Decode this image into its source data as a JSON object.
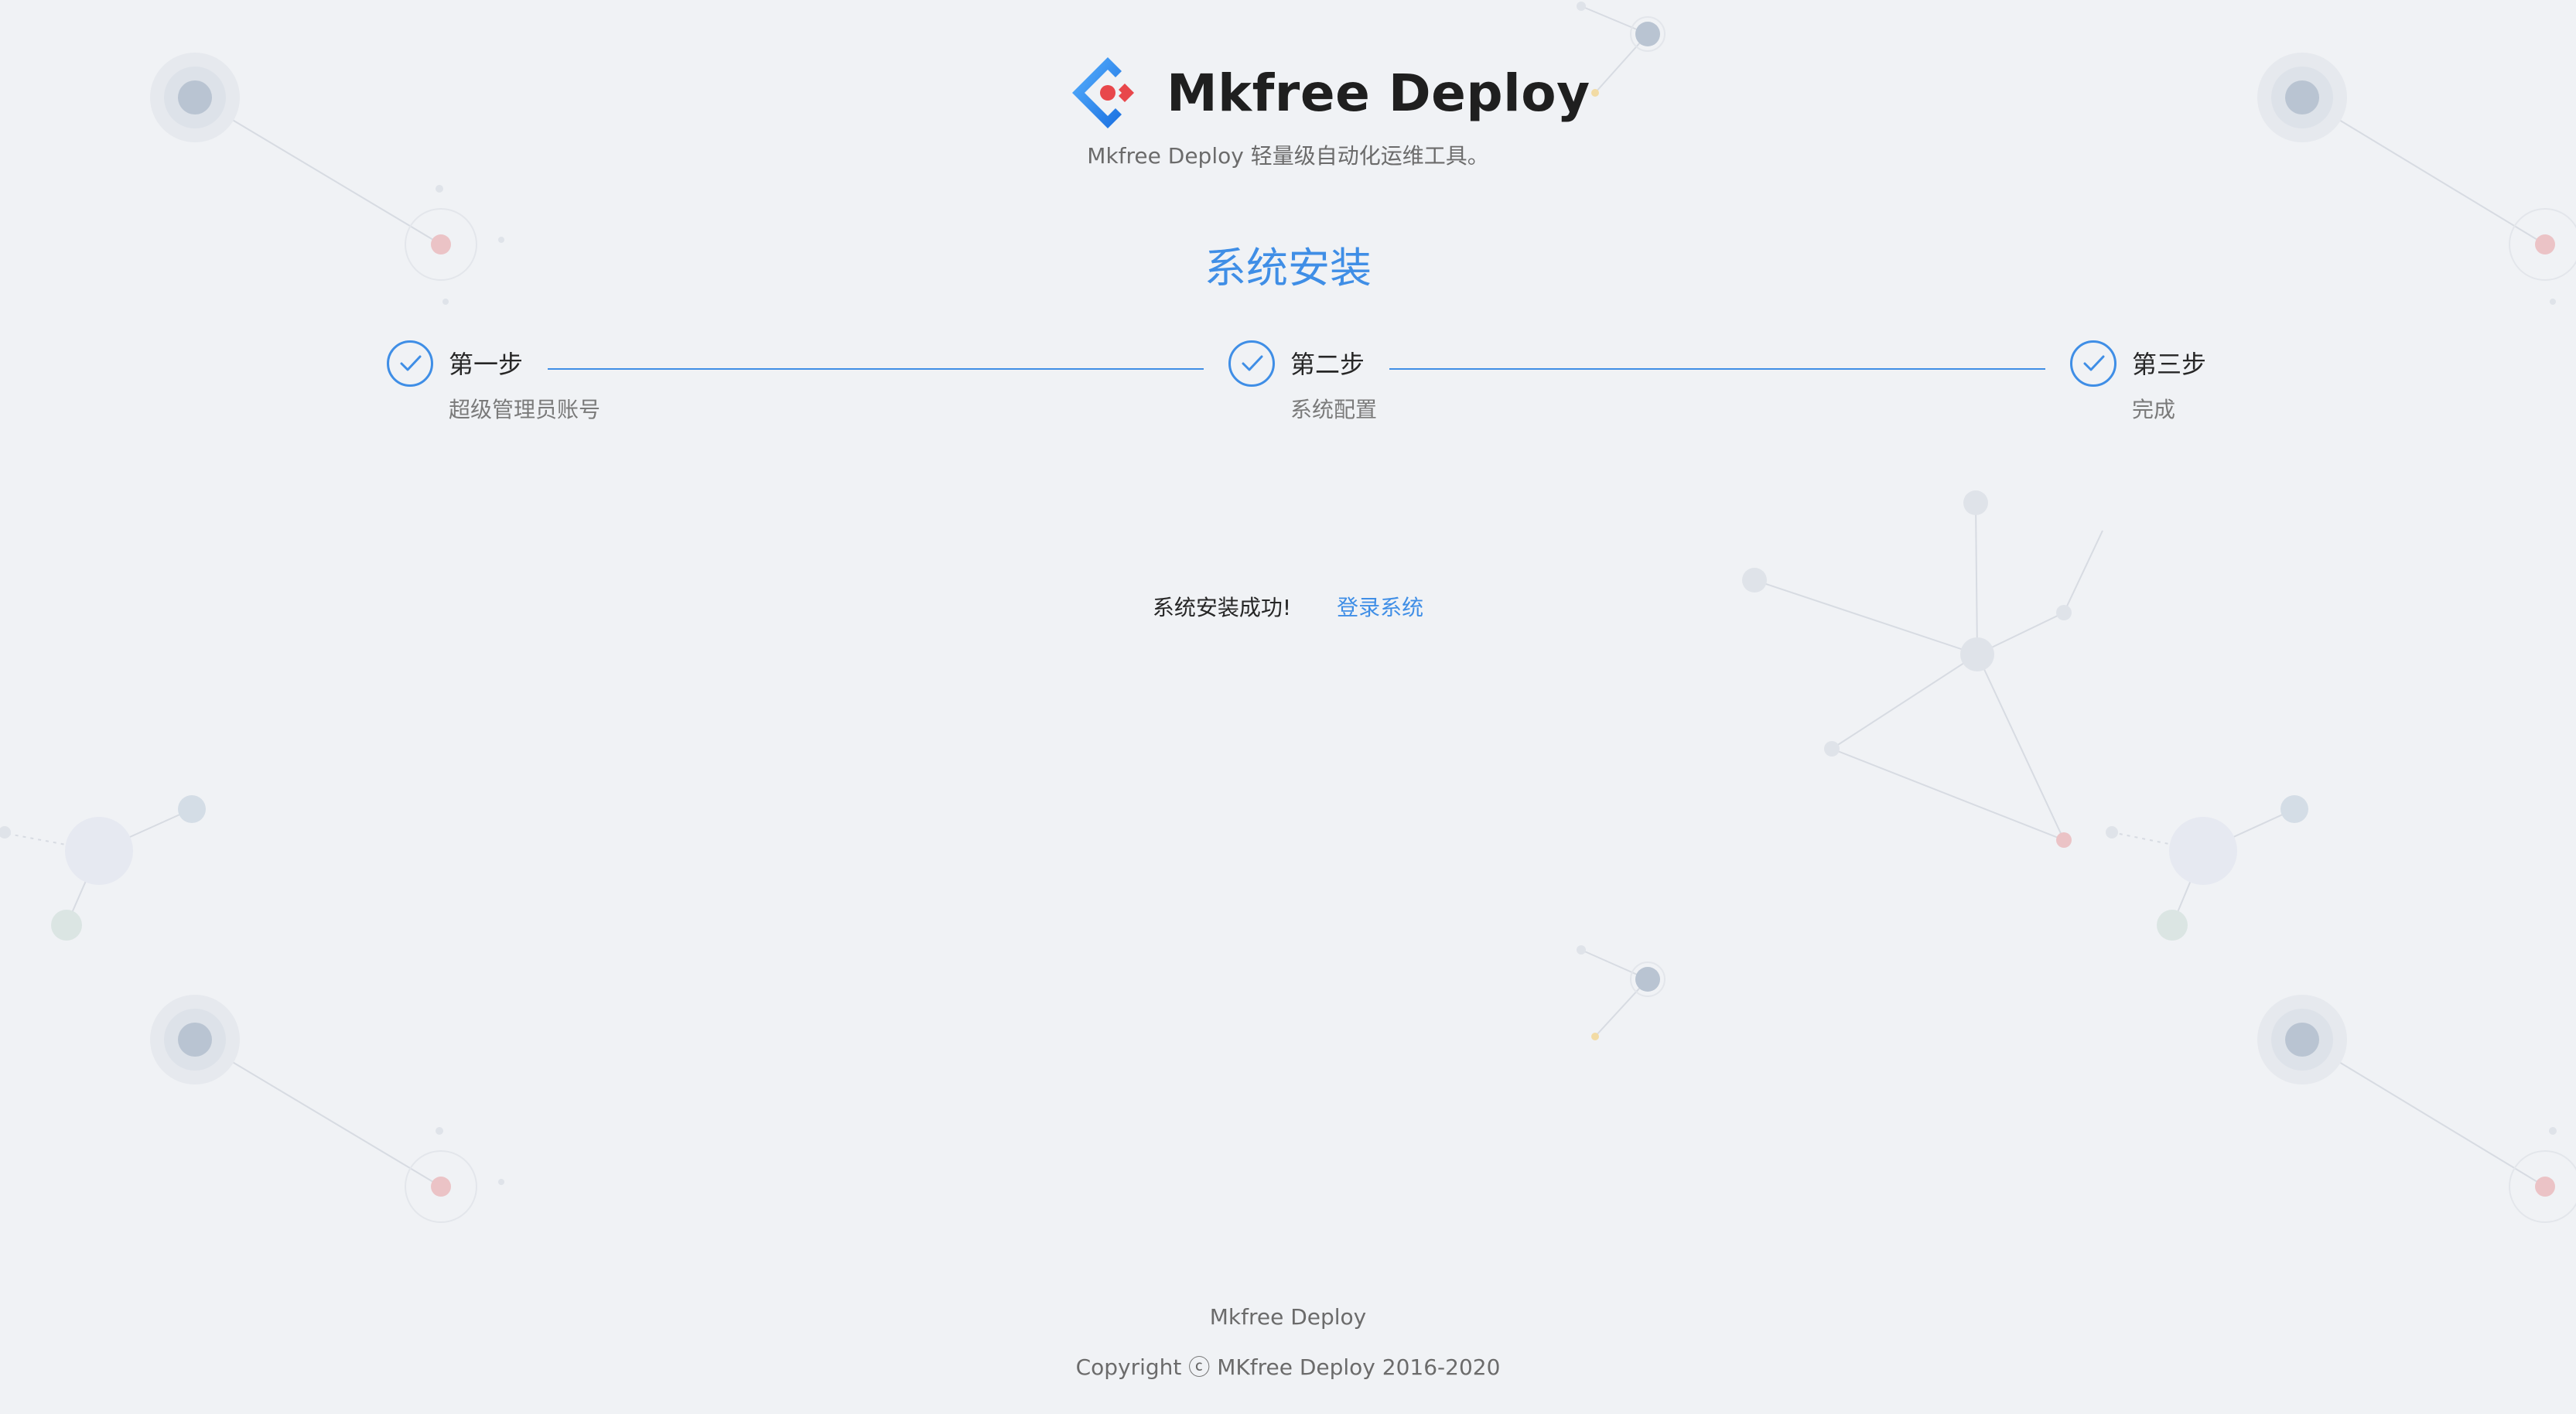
{
  "header": {
    "app_name": "Mkfree Deploy",
    "subtitle": "Mkfree Deploy 轻量级自动化运维工具。"
  },
  "page": {
    "title": "系统安装"
  },
  "steps": [
    {
      "title": "第一步",
      "description": "超级管理员账号",
      "status": "finished"
    },
    {
      "title": "第二步",
      "description": "系统配置",
      "status": "finished"
    },
    {
      "title": "第三步",
      "description": "完成",
      "status": "finished"
    }
  ],
  "result": {
    "message": "系统安装成功!",
    "login_link": "登录系统"
  },
  "footer": {
    "name": "Mkfree Deploy",
    "copyright": "Copyright ⓒ MKfree Deploy 2016-2020"
  },
  "colors": {
    "accent": "#3f8ee6",
    "background": "#f0f2f5",
    "logo_red": "#e8474b"
  }
}
